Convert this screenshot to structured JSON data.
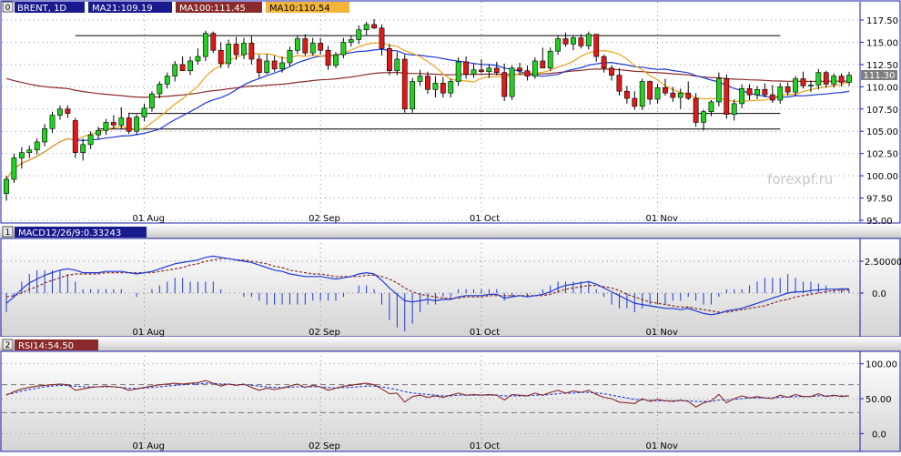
{
  "chart_data": [
    {
      "type": "candlestick",
      "panel_index": "0",
      "symbol_label": "BRENT, 1D",
      "indicators": [
        {
          "label": "MA21:109.19",
          "color": "#1e3ad6"
        },
        {
          "label": "MA100:111.45",
          "color": "#8a2a2a"
        },
        {
          "label": "MA10:110.54",
          "color": "#e8a21a"
        }
      ],
      "last_price": "111.30",
      "watermark": "forexpf.ru",
      "ylim": [
        95.0,
        117.5
      ],
      "y_ticks": [
        "95.00",
        "97.50",
        "100.00",
        "102.50",
        "105.00",
        "107.50",
        "110.00",
        "112.50",
        "115.00",
        "117.50"
      ],
      "x_ticks": [
        {
          "label": "01 Aug",
          "index": 18
        },
        {
          "label": "02 Sep",
          "index": 41
        },
        {
          "label": "01 Oct",
          "index": 62
        },
        {
          "label": "01 Nov",
          "index": 85
        }
      ],
      "candles": [
        [
          98,
          100,
          97.2,
          99.6
        ],
        [
          99.6,
          102.5,
          99.2,
          102
        ],
        [
          102,
          103.2,
          100.8,
          102.6
        ],
        [
          102.6,
          103.4,
          102,
          102.9
        ],
        [
          102.9,
          104.2,
          102.4,
          103.8
        ],
        [
          103.8,
          105.8,
          103.3,
          105.3
        ],
        [
          105.3,
          107.2,
          104.8,
          106.8
        ],
        [
          106.8,
          107.9,
          106.3,
          107.5
        ],
        [
          107.5,
          107.9,
          106.5,
          107
        ],
        [
          106.2,
          106.5,
          102,
          102.6
        ],
        [
          102.6,
          104.2,
          101.7,
          103.5
        ],
        [
          103.5,
          105,
          103,
          104.6
        ],
        [
          104.6,
          105.5,
          104.1,
          105.1
        ],
        [
          105.1,
          106.4,
          104.6,
          106
        ],
        [
          106,
          106.8,
          105.3,
          105.7
        ],
        [
          105.7,
          107.7,
          105.2,
          106.5
        ],
        [
          106.5,
          107.1,
          104.7,
          105
        ],
        [
          105,
          106.9,
          104.6,
          106.6
        ],
        [
          106.6,
          108.1,
          106.1,
          107.6
        ],
        [
          107.6,
          109.5,
          107.2,
          109.2
        ],
        [
          109.2,
          110.6,
          108.7,
          110.3
        ],
        [
          110.3,
          111.6,
          109.8,
          111.2
        ],
        [
          111.2,
          112.9,
          110.6,
          112.5
        ],
        [
          112.5,
          113.4,
          112,
          111.8
        ],
        [
          111.8,
          113.4,
          111.3,
          112.9
        ],
        [
          112.9,
          114.3,
          112.5,
          113.4
        ],
        [
          113.4,
          116.3,
          112.9,
          116
        ],
        [
          116,
          116.2,
          113.8,
          114.1
        ],
        [
          114.1,
          115,
          112.1,
          112.6
        ],
        [
          112.6,
          115.3,
          112.1,
          114.8
        ],
        [
          114.8,
          115.6,
          113,
          113.6
        ],
        [
          113.6,
          115.5,
          113.1,
          114.9
        ],
        [
          114.9,
          115.7,
          112.5,
          113.1
        ],
        [
          113.1,
          113.6,
          111,
          111.6
        ],
        [
          111.6,
          113.7,
          111.4,
          112.9
        ],
        [
          112.9,
          113.5,
          111.7,
          112
        ],
        [
          112,
          113.4,
          111.6,
          112.7
        ],
        [
          112.7,
          114.5,
          112.3,
          114.1
        ],
        [
          114.1,
          115.8,
          113.7,
          115.4
        ],
        [
          115.4,
          115.9,
          113.5,
          113.8
        ],
        [
          113.8,
          115.5,
          113.5,
          114.9
        ],
        [
          114.9,
          115.5,
          113.6,
          114.1
        ],
        [
          114.1,
          114.6,
          111.9,
          112.4
        ],
        [
          112.4,
          113.9,
          112.1,
          113.6
        ],
        [
          113.6,
          115.5,
          113.2,
          115
        ],
        [
          115,
          115.8,
          114.5,
          115.3
        ],
        [
          115.3,
          116.9,
          114.8,
          116.4
        ],
        [
          116.4,
          117.3,
          115.8,
          117
        ],
        [
          117,
          117.6,
          116.5,
          116.6
        ],
        [
          116.6,
          117,
          113.5,
          114.3
        ],
        [
          114.3,
          114.8,
          111.3,
          111.8
        ],
        [
          111.8,
          113.9,
          111.3,
          113.1
        ],
        [
          113.1,
          113.6,
          107.1,
          107.5
        ],
        [
          107.5,
          111,
          107.1,
          110.6
        ],
        [
          110.6,
          111.9,
          110.1,
          111.2
        ],
        [
          111.2,
          111.7,
          109.2,
          109.7
        ],
        [
          109.7,
          111.2,
          108.8,
          110.4
        ],
        [
          110.4,
          111.1,
          108.8,
          109.3
        ],
        [
          109.3,
          110.9,
          108.8,
          110.6
        ],
        [
          110.6,
          113.3,
          110.1,
          112.8
        ],
        [
          112.8,
          113.4,
          110.9,
          111.4
        ],
        [
          111.4,
          112.6,
          111,
          111.9
        ],
        [
          111.9,
          113.1,
          111.5,
          111.7
        ],
        [
          111.7,
          112.5,
          111,
          112.1
        ],
        [
          112.1,
          112.8,
          111.3,
          111.6
        ],
        [
          111.6,
          112.6,
          108.4,
          108.9
        ],
        [
          108.9,
          112.4,
          108.5,
          112.1
        ],
        [
          112.1,
          112.7,
          111.4,
          111.8
        ],
        [
          111.8,
          112.4,
          110.7,
          111.2
        ],
        [
          111.2,
          113.3,
          110.9,
          112.9
        ],
        [
          112.9,
          114.4,
          112.6,
          112.1
        ],
        [
          112.1,
          114.4,
          111.8,
          114
        ],
        [
          114,
          115.8,
          113.6,
          115.4
        ],
        [
          115.4,
          116.1,
          114.5,
          114.8
        ],
        [
          114.8,
          115.8,
          114.1,
          115.5
        ],
        [
          115.5,
          115.9,
          114.3,
          114.6
        ],
        [
          114.6,
          116.2,
          114.2,
          115.9
        ],
        [
          115.9,
          115.2,
          112.8,
          113.4
        ],
        [
          113.4,
          113.6,
          111.6,
          112.1
        ],
        [
          112.1,
          112.4,
          110.7,
          111.3
        ],
        [
          111.3,
          112.1,
          109,
          109.5
        ],
        [
          109.5,
          110.1,
          108.1,
          108.7
        ],
        [
          108.7,
          109.5,
          107.4,
          107.8
        ],
        [
          107.8,
          110.9,
          107.4,
          110.6
        ],
        [
          110.6,
          110.7,
          108,
          108.6
        ],
        [
          108.6,
          110.3,
          108.1,
          109.9
        ],
        [
          109.9,
          110.9,
          109,
          109.3
        ],
        [
          109.3,
          110,
          108.3,
          108.8
        ],
        [
          108.8,
          109.8,
          107.5,
          109.3
        ],
        [
          109.3,
          110.6,
          108.5,
          108.7
        ],
        [
          108.7,
          109.3,
          105.5,
          106
        ],
        [
          106,
          107.4,
          105.1,
          107.2
        ],
        [
          107.2,
          108.5,
          106.7,
          108.3
        ],
        [
          108.3,
          111.6,
          107.8,
          110.9
        ],
        [
          110.9,
          111.4,
          106.4,
          106.9
        ],
        [
          106.9,
          108.6,
          106.2,
          108.1
        ],
        [
          108.1,
          110.3,
          107.6,
          109.8
        ],
        [
          109.8,
          110.3,
          108.5,
          109.1
        ],
        [
          109.1,
          110.1,
          108.6,
          109.7
        ],
        [
          109.7,
          110.4,
          108.8,
          109.1
        ],
        [
          109.1,
          110.2,
          108.2,
          108.5
        ],
        [
          108.5,
          110.4,
          108.1,
          110
        ],
        [
          110,
          110.5,
          109,
          109.4
        ],
        [
          109.4,
          111.2,
          109,
          110.9
        ],
        [
          110.9,
          111.7,
          109.8,
          110.1
        ],
        [
          110.1,
          110.7,
          109.4,
          110.2
        ],
        [
          110.2,
          112,
          109.7,
          111.6
        ],
        [
          111.6,
          111.8,
          109.9,
          110.3
        ],
        [
          110.3,
          111.5,
          109.9,
          111.2
        ],
        [
          111.2,
          111.5,
          110,
          110.5
        ],
        [
          110.5,
          111.7,
          110.1,
          111.3
        ]
      ],
      "horizontal_lines": [
        {
          "y": 115.75,
          "from": 9,
          "to": 101
        },
        {
          "y": 107.0,
          "from": 16,
          "to": 101
        },
        {
          "y": 105.25,
          "from": 12,
          "to": 101
        }
      ]
    },
    {
      "type": "line",
      "panel_index": "1",
      "label": "MACD12/26/9:0.33243",
      "ylim": [
        -3.0,
        4.0
      ],
      "y_ticks": [
        "0.0",
        "2.50000"
      ],
      "series": [
        {
          "name": "MACD",
          "color": "#1e3ad6",
          "values": [
            -0.8,
            -0.3,
            0.3,
            0.8,
            1.1,
            1.4,
            1.6,
            1.8,
            1.9,
            1.8,
            1.6,
            1.6,
            1.6,
            1.7,
            1.7,
            1.7,
            1.6,
            1.5,
            1.6,
            1.7,
            1.9,
            2.1,
            2.3,
            2.4,
            2.5,
            2.6,
            2.8,
            2.9,
            2.8,
            2.7,
            2.6,
            2.5,
            2.4,
            2.2,
            2.0,
            1.8,
            1.7,
            1.5,
            1.4,
            1.3,
            1.3,
            1.3,
            1.2,
            1.1,
            1.2,
            1.3,
            1.5,
            1.6,
            1.5,
            1.0,
            0.4,
            -0.1,
            -0.6,
            -0.7,
            -0.6,
            -0.5,
            -0.6,
            -0.5,
            -0.5,
            -0.3,
            -0.2,
            -0.2,
            -0.2,
            -0.1,
            -0.1,
            -0.4,
            -0.3,
            -0.2,
            -0.3,
            -0.2,
            -0.1,
            0.1,
            0.4,
            0.6,
            0.7,
            0.8,
            0.9,
            0.7,
            0.4,
            0.1,
            -0.2,
            -0.5,
            -0.8,
            -0.9,
            -1.0,
            -1.1,
            -1.2,
            -1.2,
            -1.3,
            -1.2,
            -1.4,
            -1.6,
            -1.7,
            -1.6,
            -1.4,
            -1.3,
            -1.2,
            -1.0,
            -0.8,
            -0.6,
            -0.4,
            -0.2,
            0.0,
            0.1,
            0.1,
            0.2,
            0.25,
            0.3,
            0.3,
            0.33,
            0.33
          ]
        },
        {
          "name": "Signal",
          "color": "#8a2a2a",
          "values": [
            -0.3,
            -0.2,
            0.0,
            0.3,
            0.5,
            0.8,
            1.0,
            1.2,
            1.4,
            1.5,
            1.5,
            1.5,
            1.5,
            1.6,
            1.6,
            1.6,
            1.6,
            1.6,
            1.6,
            1.6,
            1.7,
            1.8,
            1.9,
            2.0,
            2.2,
            2.3,
            2.5,
            2.6,
            2.7,
            2.7,
            2.6,
            2.6,
            2.5,
            2.4,
            2.3,
            2.1,
            2.0,
            1.8,
            1.7,
            1.6,
            1.5,
            1.5,
            1.4,
            1.3,
            1.3,
            1.3,
            1.3,
            1.4,
            1.4,
            1.3,
            1.1,
            0.8,
            0.4,
            0.1,
            -0.1,
            -0.2,
            -0.3,
            -0.4,
            -0.4,
            -0.4,
            -0.3,
            -0.3,
            -0.3,
            -0.2,
            -0.2,
            -0.2,
            -0.2,
            -0.2,
            -0.2,
            -0.2,
            -0.2,
            -0.1,
            0.1,
            0.3,
            0.4,
            0.5,
            0.6,
            0.6,
            0.5,
            0.4,
            0.2,
            -0.1,
            -0.3,
            -0.5,
            -0.7,
            -0.8,
            -0.9,
            -1.0,
            -1.1,
            -1.1,
            -1.2,
            -1.3,
            -1.4,
            -1.5,
            -1.5,
            -1.4,
            -1.3,
            -1.2,
            -1.1,
            -1.0,
            -0.8,
            -0.6,
            -0.5,
            -0.3,
            -0.2,
            -0.1,
            0.0,
            0.1,
            0.2,
            0.2,
            0.25
          ]
        }
      ]
    },
    {
      "type": "line",
      "panel_index": "2",
      "label": "RSI14:54.50",
      "ylim": [
        -10,
        110
      ],
      "y_ticks": [
        "0.0",
        "50.00",
        "100.00"
      ],
      "reference_lines": [
        70,
        30
      ],
      "series": [
        {
          "name": "RSI",
          "color": "#8a2a2a",
          "values": [
            55,
            60,
            64,
            66,
            68,
            69,
            70,
            71,
            70,
            62,
            64,
            66,
            67,
            68,
            67,
            66,
            62,
            64,
            66,
            68,
            70,
            71,
            72,
            71,
            72,
            73,
            76,
            72,
            68,
            71,
            69,
            71,
            66,
            62,
            65,
            63,
            65,
            68,
            71,
            66,
            69,
            67,
            62,
            65,
            68,
            69,
            71,
            72,
            70,
            64,
            57,
            58,
            45,
            53,
            55,
            52,
            54,
            52,
            55,
            58,
            55,
            56,
            55,
            56,
            55,
            48,
            56,
            55,
            54,
            58,
            55,
            59,
            62,
            58,
            61,
            59,
            62,
            56,
            52,
            50,
            45,
            44,
            43,
            50,
            46,
            49,
            47,
            46,
            48,
            46,
            38,
            44,
            47,
            56,
            44,
            50,
            54,
            51,
            53,
            51,
            50,
            55,
            52,
            56,
            53,
            53,
            57,
            53,
            55,
            53,
            54
          ]
        },
        {
          "name": "RSI MA",
          "color": "#1e3ad6",
          "values": [
            56,
            58,
            61,
            63,
            65,
            67,
            68,
            69,
            69,
            68,
            67,
            67,
            67,
            67,
            67,
            66,
            65,
            65,
            65,
            66,
            67,
            68,
            69,
            70,
            71,
            71,
            72,
            72,
            71,
            71,
            70,
            70,
            69,
            68,
            67,
            66,
            66,
            66,
            67,
            67,
            67,
            67,
            66,
            65,
            66,
            66,
            67,
            68,
            68,
            67,
            65,
            63,
            60,
            58,
            57,
            56,
            55,
            54,
            54,
            55,
            55,
            55,
            55,
            55,
            55,
            54,
            54,
            54,
            54,
            55,
            55,
            56,
            57,
            58,
            58,
            59,
            59,
            58,
            57,
            55,
            53,
            51,
            49,
            48,
            48,
            47,
            47,
            47,
            47,
            47,
            46,
            46,
            46,
            48,
            48,
            49,
            50,
            51,
            51,
            51,
            51,
            52,
            52,
            53,
            53,
            53,
            54,
            54,
            54,
            54,
            54
          ]
        }
      ]
    }
  ]
}
